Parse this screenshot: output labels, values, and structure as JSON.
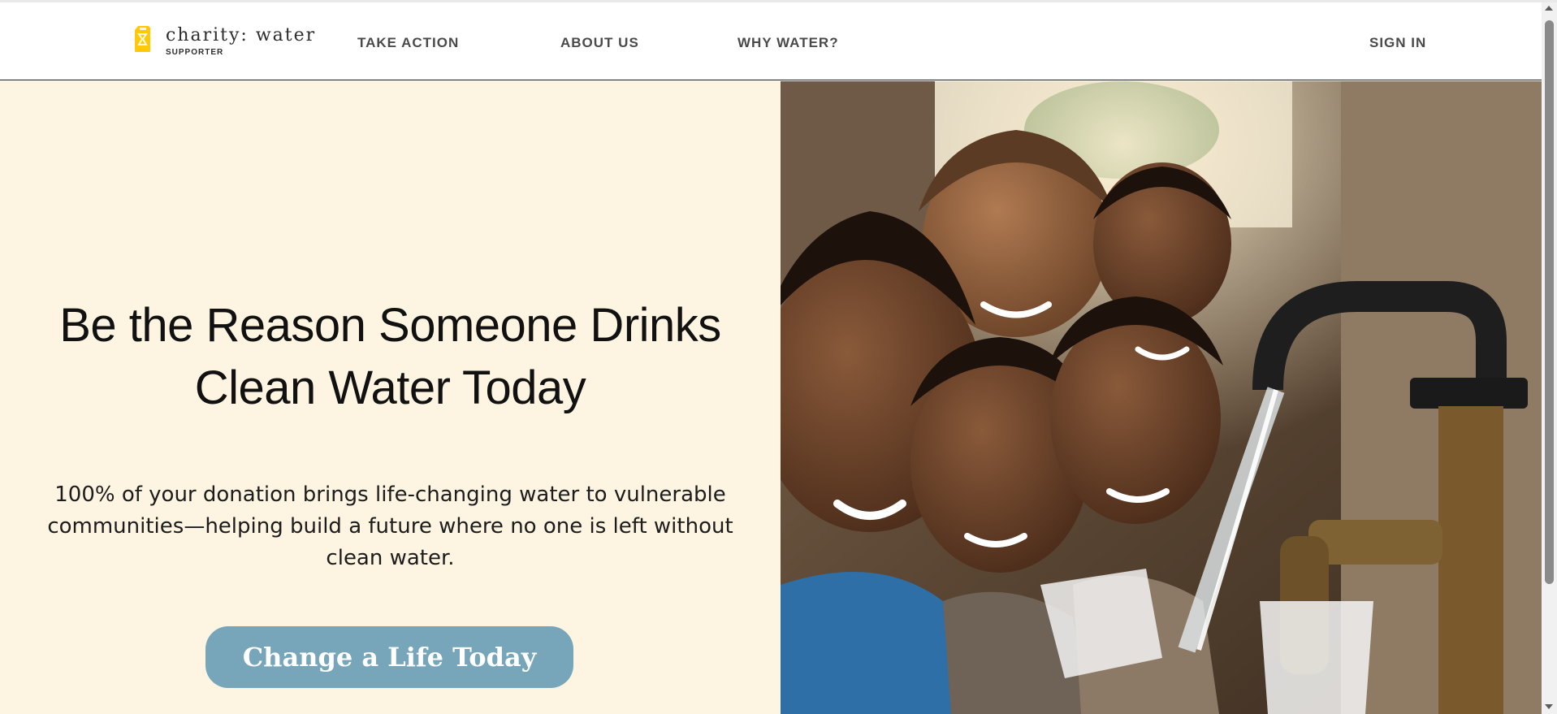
{
  "header": {
    "logo_name": "charity: water",
    "logo_sub": "SUPPORTER",
    "nav": [
      "TAKE ACTION",
      "ABOUT US",
      "WHY WATER?"
    ],
    "sign_in": "SIGN IN"
  },
  "hero": {
    "title_line1": "Be the Reason Someone Drinks",
    "title_line2": "Clean Water Today",
    "subtitle_line1": "100% of your donation brings life-changing water to vulnerable",
    "subtitle_line2": "communities—helping build a future where no one is left without",
    "subtitle_line3": "clean water.",
    "cta_label": "Change a Life Today"
  },
  "colors": {
    "brand_yellow": "#ffc907",
    "hero_background": "#fdf5e1",
    "cta": "#77a6bb"
  },
  "icons": {
    "logo": "jerrycan-icon"
  }
}
